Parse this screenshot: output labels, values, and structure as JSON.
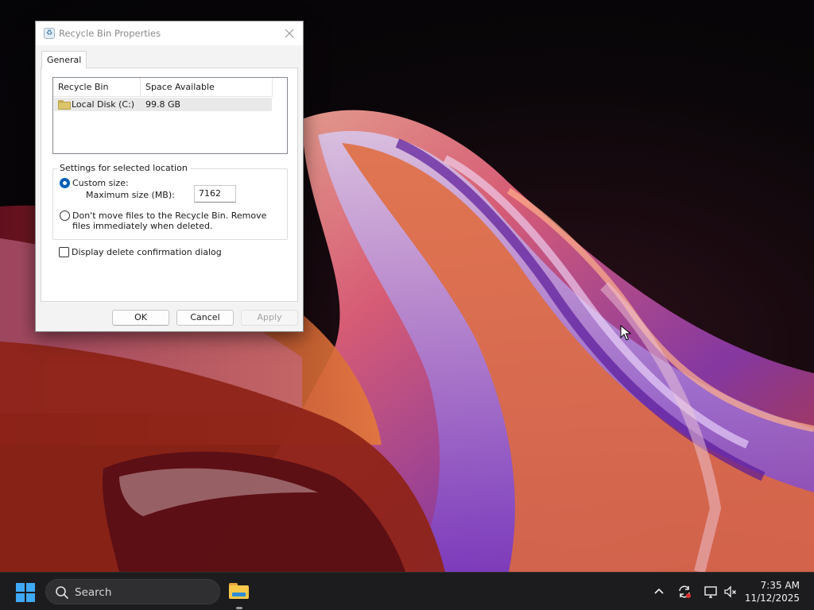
{
  "dialog": {
    "title": "Recycle Bin Properties",
    "tab_label": "General",
    "list": {
      "columns": [
        "Recycle Bin Location",
        "Space Available"
      ],
      "rows": [
        {
          "location": "Local Disk (C:)",
          "space": "99.8 GB",
          "icon": "folder-icon",
          "selected": true
        }
      ]
    },
    "settings": {
      "legend": "Settings for selected location",
      "custom_size_label": "Custom size:",
      "custom_size_checked": true,
      "max_size_label": "Maximum size (MB):",
      "max_size_value": "7162",
      "no_move_label": "Don't move files to the Recycle Bin. Remove files immediately when deleted.",
      "no_move_checked": false
    },
    "confirm_label": "Display delete confirmation dialog",
    "confirm_checked": false,
    "buttons": {
      "ok": "OK",
      "cancel": "Cancel",
      "apply": "Apply"
    }
  },
  "taskbar": {
    "search_placeholder": "Search",
    "pinned_apps": [
      "file-explorer-icon"
    ],
    "tray_icons": [
      "chevron-up-icon",
      "sync-icon",
      "display-icon",
      "volume-muted-icon"
    ],
    "time": "7:35 AM",
    "date": "11/12/2025"
  },
  "colors": {
    "accent": "#005fb8",
    "start_blue": "#3fa9f5",
    "taskbar_bg": "#1c1c1e"
  }
}
